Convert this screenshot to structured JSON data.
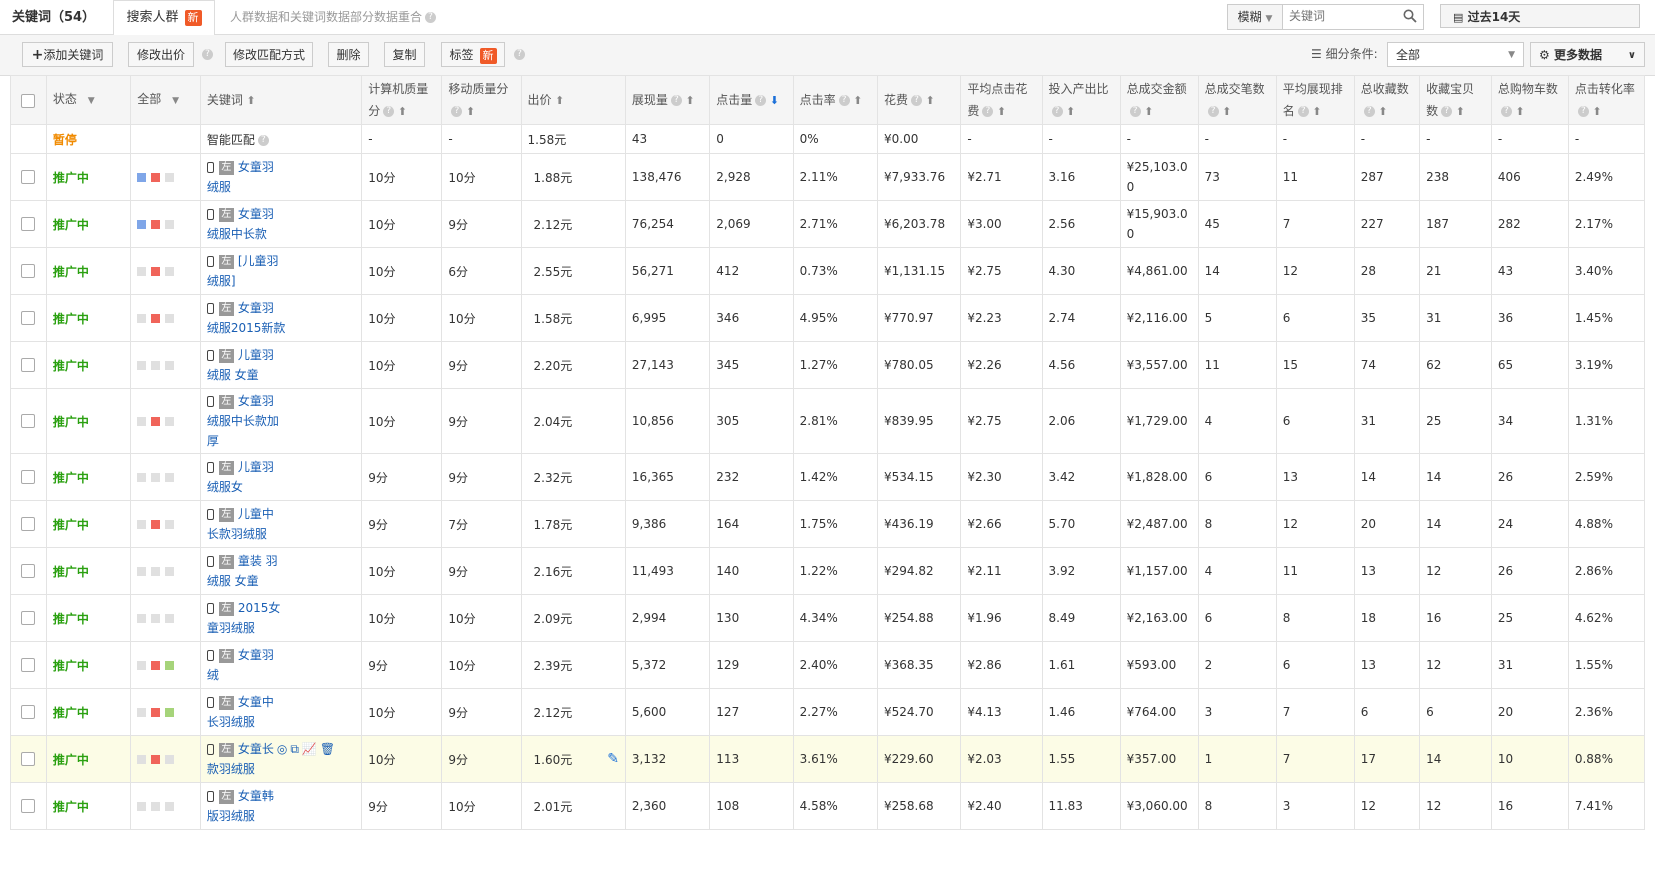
{
  "tabs": {
    "keywords_label": "关键词（54）",
    "crowd_label": "搜索人群",
    "new_badge": "新",
    "note": "人群数据和关键词数据部分数据重合"
  },
  "filters": {
    "match_mode": "模糊",
    "keyword_placeholder": "关键词",
    "date_range": "过去14天"
  },
  "toolbar": {
    "add_keyword": "添加关键词",
    "edit_bid": "修改出价",
    "edit_match": "修改匹配方式",
    "delete": "删除",
    "copy": "复制",
    "tag": "标签",
    "tag_badge": "新",
    "segment_label": "细分条件:",
    "segment_value": "全部",
    "more_data": "更多数据"
  },
  "columns": [
    "状态",
    "全部",
    "关键词",
    "计算机质量分",
    "移动质量分",
    "出价",
    "展现量",
    "点击量",
    "点击率",
    "花费",
    "平均点击花费",
    "投入产出比",
    "总成交金额",
    "总成交笔数",
    "平均展现排名",
    "总收藏数",
    "收藏宝贝数",
    "总购物车数",
    "点击转化率"
  ],
  "smart_row": {
    "status": "暂停",
    "keyword": "智能匹配",
    "pc_q": "-",
    "mob_q": "-",
    "bid": "1.58元",
    "impr": "43",
    "clicks": "0",
    "ctr": "0%",
    "cost": "¥0.00",
    "cpc": "-",
    "roi": "-",
    "gmv": "-",
    "orders": "-",
    "rank": "-",
    "fav": "-",
    "favitem": "-",
    "cart": "-",
    "cvr": "-"
  },
  "rows": [
    {
      "status": "推广中",
      "kw": "女童羽绒服",
      "pc_q": "10分",
      "mob_q": "10分",
      "bid": "1.88元",
      "impr": "138,476",
      "clicks": "2,928",
      "ctr": "2.11%",
      "cost": "¥7,933.76",
      "cpc": "¥2.71",
      "roi": "3.16",
      "gmv": "¥25,103.00",
      "orders": "73",
      "rank": "11",
      "fav": "287",
      "favitem": "238",
      "cart": "406",
      "cvr": "2.49%"
    },
    {
      "status": "推广中",
      "kw": "女童羽绒服中长款",
      "pc_q": "10分",
      "mob_q": "9分",
      "bid": "2.12元",
      "impr": "76,254",
      "clicks": "2,069",
      "ctr": "2.71%",
      "cost": "¥6,203.78",
      "cpc": "¥3.00",
      "roi": "2.56",
      "gmv": "¥15,903.00",
      "orders": "45",
      "rank": "7",
      "fav": "227",
      "favitem": "187",
      "cart": "282",
      "cvr": "2.17%"
    },
    {
      "status": "推广中",
      "kw": "[儿童羽绒服]",
      "pc_q": "10分",
      "mob_q": "6分",
      "bid": "2.55元",
      "impr": "56,271",
      "clicks": "412",
      "ctr": "0.73%",
      "cost": "¥1,131.15",
      "cpc": "¥2.75",
      "roi": "4.30",
      "gmv": "¥4,861.00",
      "orders": "14",
      "rank": "12",
      "fav": "28",
      "favitem": "21",
      "cart": "43",
      "cvr": "3.40%"
    },
    {
      "status": "推广中",
      "kw": "女童羽绒服2015新款",
      "pc_q": "10分",
      "mob_q": "10分",
      "bid": "1.58元",
      "impr": "6,995",
      "clicks": "346",
      "ctr": "4.95%",
      "cost": "¥770.97",
      "cpc": "¥2.23",
      "roi": "2.74",
      "gmv": "¥2,116.00",
      "orders": "5",
      "rank": "6",
      "fav": "35",
      "favitem": "31",
      "cart": "36",
      "cvr": "1.45%"
    },
    {
      "status": "推广中",
      "kw": "儿童羽绒服 女童",
      "pc_q": "10分",
      "mob_q": "9分",
      "bid": "2.20元",
      "impr": "27,143",
      "clicks": "345",
      "ctr": "1.27%",
      "cost": "¥780.05",
      "cpc": "¥2.26",
      "roi": "4.56",
      "gmv": "¥3,557.00",
      "orders": "11",
      "rank": "15",
      "fav": "74",
      "favitem": "62",
      "cart": "65",
      "cvr": "3.19%"
    },
    {
      "status": "推广中",
      "kw": "女童羽绒服中长款加厚",
      "pc_q": "10分",
      "mob_q": "9分",
      "bid": "2.04元",
      "impr": "10,856",
      "clicks": "305",
      "ctr": "2.81%",
      "cost": "¥839.95",
      "cpc": "¥2.75",
      "roi": "2.06",
      "gmv": "¥1,729.00",
      "orders": "4",
      "rank": "6",
      "fav": "31",
      "favitem": "25",
      "cart": "34",
      "cvr": "1.31%"
    },
    {
      "status": "推广中",
      "kw": "儿童羽绒服女",
      "pc_q": "9分",
      "mob_q": "9分",
      "bid": "2.32元",
      "impr": "16,365",
      "clicks": "232",
      "ctr": "1.42%",
      "cost": "¥534.15",
      "cpc": "¥2.30",
      "roi": "3.42",
      "gmv": "¥1,828.00",
      "orders": "6",
      "rank": "13",
      "fav": "14",
      "favitem": "14",
      "cart": "26",
      "cvr": "2.59%"
    },
    {
      "status": "推广中",
      "kw": "儿童中长款羽绒服",
      "pc_q": "9分",
      "mob_q": "7分",
      "bid": "1.78元",
      "impr": "9,386",
      "clicks": "164",
      "ctr": "1.75%",
      "cost": "¥436.19",
      "cpc": "¥2.66",
      "roi": "5.70",
      "gmv": "¥2,487.00",
      "orders": "8",
      "rank": "12",
      "fav": "20",
      "favitem": "14",
      "cart": "24",
      "cvr": "4.88%"
    },
    {
      "status": "推广中",
      "kw": "童装 羽绒服 女童",
      "pc_q": "10分",
      "mob_q": "9分",
      "bid": "2.16元",
      "impr": "11,493",
      "clicks": "140",
      "ctr": "1.22%",
      "cost": "¥294.82",
      "cpc": "¥2.11",
      "roi": "3.92",
      "gmv": "¥1,157.00",
      "orders": "4",
      "rank": "11",
      "fav": "13",
      "favitem": "12",
      "cart": "26",
      "cvr": "2.86%"
    },
    {
      "status": "推广中",
      "kw": "2015女童羽绒服",
      "pc_q": "10分",
      "mob_q": "10分",
      "bid": "2.09元",
      "impr": "2,994",
      "clicks": "130",
      "ctr": "4.34%",
      "cost": "¥254.88",
      "cpc": "¥1.96",
      "roi": "8.49",
      "gmv": "¥2,163.00",
      "orders": "6",
      "rank": "8",
      "fav": "18",
      "favitem": "16",
      "cart": "25",
      "cvr": "4.62%"
    },
    {
      "status": "推广中",
      "kw": "女童羽绒",
      "pc_q": "9分",
      "mob_q": "10分",
      "bid": "2.39元",
      "impr": "5,372",
      "clicks": "129",
      "ctr": "2.40%",
      "cost": "¥368.35",
      "cpc": "¥2.86",
      "roi": "1.61",
      "gmv": "¥593.00",
      "orders": "2",
      "rank": "6",
      "fav": "13",
      "favitem": "12",
      "cart": "31",
      "cvr": "1.55%"
    },
    {
      "status": "推广中",
      "kw": "女童中长羽绒服",
      "pc_q": "10分",
      "mob_q": "9分",
      "bid": "2.12元",
      "impr": "5,600",
      "clicks": "127",
      "ctr": "2.27%",
      "cost": "¥524.70",
      "cpc": "¥4.13",
      "roi": "1.46",
      "gmv": "¥764.00",
      "orders": "3",
      "rank": "7",
      "fav": "6",
      "favitem": "6",
      "cart": "20",
      "cvr": "2.36%"
    },
    {
      "status": "推广中",
      "kw": "女童长款羽绒服",
      "pc_q": "10分",
      "mob_q": "9分",
      "bid": "1.60元",
      "impr": "3,132",
      "clicks": "113",
      "ctr": "3.61%",
      "cost": "¥229.60",
      "cpc": "¥2.03",
      "roi": "1.55",
      "gmv": "¥357.00",
      "orders": "1",
      "rank": "7",
      "fav": "17",
      "favitem": "14",
      "cart": "10",
      "cvr": "0.88%"
    },
    {
      "status": "推广中",
      "kw": "女童韩版羽绒服",
      "pc_q": "9分",
      "mob_q": "10分",
      "bid": "2.01元",
      "impr": "2,360",
      "clicks": "108",
      "ctr": "4.58%",
      "cost": "¥258.68",
      "cpc": "¥2.40",
      "roi": "11.83",
      "gmv": "¥3,060.00",
      "orders": "8",
      "rank": "3",
      "fav": "12",
      "favitem": "12",
      "cart": "16",
      "cvr": "7.41%"
    }
  ],
  "kw_lines": [
    [
      "女童羽",
      "绒服"
    ],
    [
      "女童羽",
      "绒服中长款"
    ],
    [
      "[儿童羽",
      "绒服]"
    ],
    [
      "女童羽",
      "绒服2015新款"
    ],
    [
      "儿童羽",
      "绒服 女童"
    ],
    [
      "女童羽",
      "绒服中长款加",
      "厚"
    ],
    [
      "儿童羽",
      "绒服女"
    ],
    [
      "儿童中",
      "长款羽绒服"
    ],
    [
      "童装 羽",
      "绒服 女童"
    ],
    [
      "2015女",
      "童羽绒服"
    ],
    [
      "女童羽",
      "绒"
    ],
    [
      "女童中",
      "长羽绒服"
    ],
    [
      "女童长",
      "款羽绒服"
    ],
    [
      "女童韩",
      "版羽绒服"
    ]
  ],
  "gmv_lines": [
    [
      "¥25,103.0",
      "0"
    ],
    [
      "¥15,903.0",
      "0"
    ]
  ],
  "device_tag": "左",
  "colors": {
    "promo": "#2aa010",
    "pause": "#f08a00",
    "link": "#1a5fb4",
    "badge": "#f05a28",
    "sq_blue": "#7fa6e8",
    "sq_red": "#f0645a",
    "sq_green": "#a6d47a",
    "sq_gray": "#e0e0e0"
  },
  "dot_sets": [
    [
      "blue",
      "red",
      "gray"
    ],
    [
      "blue",
      "red",
      "gray"
    ],
    [
      "gray",
      "red",
      "gray"
    ],
    [
      "gray",
      "red",
      "gray"
    ],
    [
      "gray",
      "gray",
      "gray"
    ],
    [
      "gray",
      "red",
      "gray"
    ],
    [
      "gray",
      "gray",
      "gray"
    ],
    [
      "gray",
      "red",
      "gray"
    ],
    [
      "gray",
      "gray",
      "gray"
    ],
    [
      "gray",
      "gray",
      "gray"
    ],
    [
      "gray",
      "red",
      "green"
    ],
    [
      "gray",
      "red",
      "green"
    ],
    [
      "gray",
      "red",
      "gray"
    ],
    [
      "gray",
      "gray",
      "gray"
    ]
  ]
}
